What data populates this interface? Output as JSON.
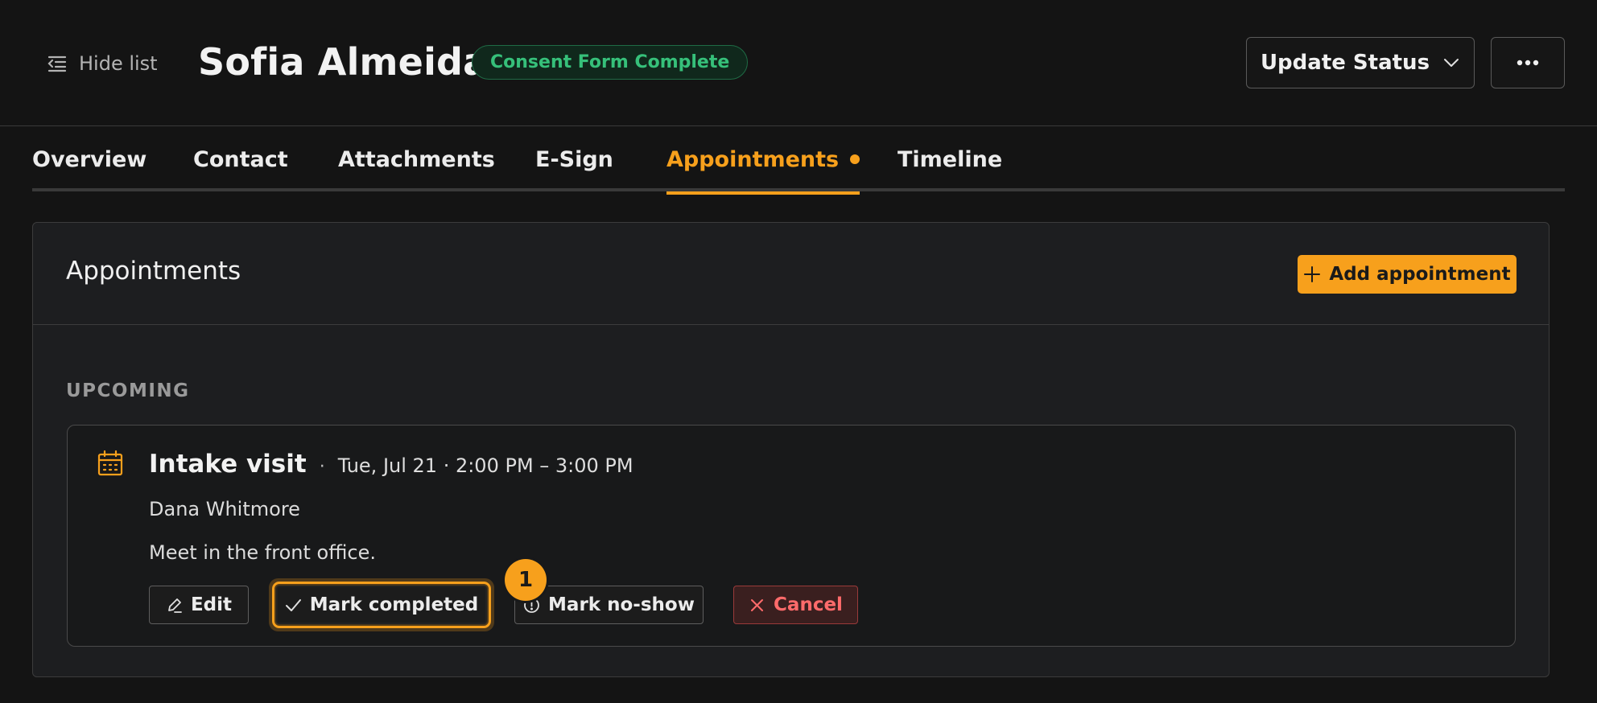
{
  "header": {
    "hide_list_label": "Hide list",
    "title": "Sofia Almeida",
    "status_badge": "Consent Form Complete",
    "update_status_label": "Update Status",
    "more_icon": "ellipsis-icon"
  },
  "tabs": [
    {
      "label": "Overview",
      "active": false
    },
    {
      "label": "Contact",
      "active": false
    },
    {
      "label": "Attachments",
      "active": false
    },
    {
      "label": "E-Sign",
      "active": false
    },
    {
      "label": "Appointments",
      "active": true,
      "indicator": true
    },
    {
      "label": "Timeline",
      "active": false
    }
  ],
  "panel": {
    "title": "Appointments",
    "add_label": "Add appointment",
    "section_label": "UPCOMING",
    "appointment": {
      "name": "Intake visit",
      "separator": "·",
      "datetime": "Tue, Jul 21 · 2:00 PM – 3:00 PM",
      "person": "Dana Whitmore",
      "note": "Meet in the front office.",
      "actions": {
        "edit": "Edit",
        "complete": "Mark completed",
        "noshow": "Mark no-show",
        "cancel": "Cancel"
      }
    }
  },
  "highlight": {
    "step_number": "1",
    "target": "Mark completed"
  },
  "colors": {
    "accent": "#f7a01c",
    "success": "#36c07a",
    "danger": "#ff6b6b",
    "background": "#141414"
  }
}
